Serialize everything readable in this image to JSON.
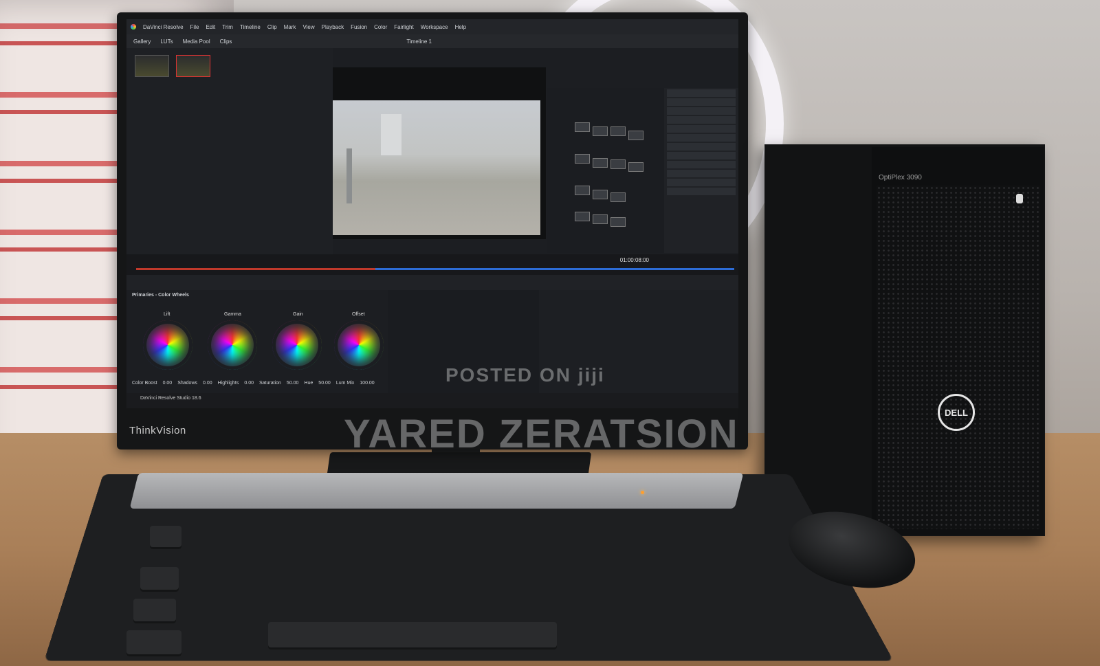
{
  "scene": {
    "monitor_brand": "ThinkVision",
    "tower_model": "OptiPlex 3090",
    "tower_brand": "DELL"
  },
  "app": {
    "title": "DaVinci Resolve",
    "menu": [
      "File",
      "Edit",
      "Trim",
      "Timeline",
      "Clip",
      "Mark",
      "View",
      "Playback",
      "Fusion",
      "Color",
      "Fairlight",
      "Workspace",
      "Help"
    ],
    "toolbar": [
      "Gallery",
      "LUTs",
      "Media Pool",
      "Clips"
    ],
    "timeline_name": "Timeline 1",
    "timecode": "01:00:08:00",
    "panel_title": "Primaries - Color Wheels",
    "wheels": [
      "Lift",
      "Gamma",
      "Gain",
      "Offset"
    ],
    "studio_label": "DaVinci Resolve Studio 18.6",
    "bottom_fields": [
      {
        "label": "Color Boost",
        "value": "0.00"
      },
      {
        "label": "Shadows",
        "value": "0.00"
      },
      {
        "label": "Highlights",
        "value": "0.00"
      },
      {
        "label": "Saturation",
        "value": "50.00"
      },
      {
        "label": "Hue",
        "value": "50.00"
      },
      {
        "label": "Lum Mix",
        "value": "100.00"
      }
    ]
  },
  "watermark": {
    "line1": "POSTED ON jiji",
    "line2": "YARED ZERATSION"
  }
}
